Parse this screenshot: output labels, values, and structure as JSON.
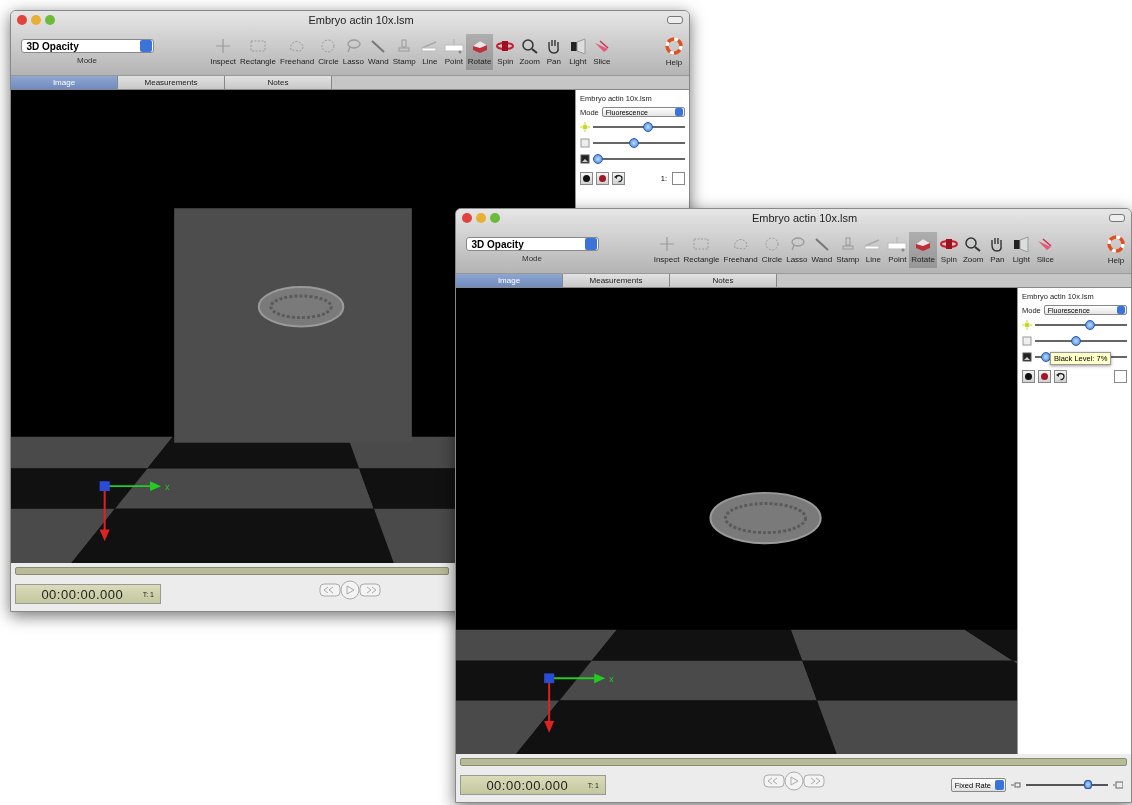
{
  "windows": [
    {
      "title": "Embryo actin 10x.lsm",
      "mode": {
        "value": "3D Opacity",
        "label": "Mode"
      },
      "tools": [
        {
          "label": "Inspect",
          "kind": "crosshair",
          "selected": false
        },
        {
          "label": "Rectangle",
          "kind": "rectangle",
          "selected": false
        },
        {
          "label": "Freehand",
          "kind": "freehand",
          "selected": false
        },
        {
          "label": "Circle",
          "kind": "circle",
          "selected": false
        },
        {
          "label": "Lasso",
          "kind": "lasso",
          "selected": false
        },
        {
          "label": "Wand",
          "kind": "wand",
          "selected": false
        },
        {
          "label": "Stamp",
          "kind": "stamp",
          "selected": false
        },
        {
          "label": "Line",
          "kind": "line",
          "selected": false
        },
        {
          "label": "Point",
          "kind": "point",
          "selected": false
        },
        {
          "label": "Rotate",
          "kind": "rotate",
          "selected": true
        },
        {
          "label": "Spin",
          "kind": "spin",
          "selected": false
        },
        {
          "label": "Zoom",
          "kind": "zoom",
          "selected": false
        },
        {
          "label": "Pan",
          "kind": "pan",
          "selected": false
        },
        {
          "label": "Light",
          "kind": "light",
          "selected": false
        },
        {
          "label": "Slice",
          "kind": "slice",
          "selected": false
        }
      ],
      "help": "Help",
      "tabs": [
        {
          "label": "Image",
          "selected": true
        },
        {
          "label": "Measurements",
          "selected": false
        },
        {
          "label": "Notes",
          "selected": false
        }
      ],
      "viewport": {
        "volume_plane": true,
        "axis_label": "x"
      },
      "panel": {
        "title": "Embryo actin 10x.lsm",
        "mode_label": "Mode",
        "mode_value": "Fluorescence",
        "sliders": [
          {
            "kind": "brightness",
            "level": 0.6
          },
          {
            "kind": "contrast",
            "level": 0.45
          },
          {
            "kind": "black",
            "level": 0.05
          }
        ],
        "channel_label": "1:",
        "channel_checked": false
      },
      "timecode": "00:00:00.000",
      "timepoint": "T: 1"
    },
    {
      "title": "Embryo actin 10x.lsm",
      "mode": {
        "value": "3D Opacity",
        "label": "Mode"
      },
      "tools": [
        {
          "label": "Inspect",
          "kind": "crosshair",
          "selected": false
        },
        {
          "label": "Rectangle",
          "kind": "rectangle",
          "selected": false
        },
        {
          "label": "Freehand",
          "kind": "freehand",
          "selected": false
        },
        {
          "label": "Circle",
          "kind": "circle",
          "selected": false
        },
        {
          "label": "Lasso",
          "kind": "lasso",
          "selected": false
        },
        {
          "label": "Wand",
          "kind": "wand",
          "selected": false
        },
        {
          "label": "Stamp",
          "kind": "stamp",
          "selected": false
        },
        {
          "label": "Line",
          "kind": "line",
          "selected": false
        },
        {
          "label": "Point",
          "kind": "point",
          "selected": false
        },
        {
          "label": "Rotate",
          "kind": "rotate",
          "selected": true
        },
        {
          "label": "Spin",
          "kind": "spin",
          "selected": false
        },
        {
          "label": "Zoom",
          "kind": "zoom",
          "selected": false
        },
        {
          "label": "Pan",
          "kind": "pan",
          "selected": false
        },
        {
          "label": "Light",
          "kind": "light",
          "selected": false
        },
        {
          "label": "Slice",
          "kind": "slice",
          "selected": false
        }
      ],
      "help": "Help",
      "tabs": [
        {
          "label": "Image",
          "selected": true
        },
        {
          "label": "Measurements",
          "selected": false
        },
        {
          "label": "Notes",
          "selected": false
        }
      ],
      "viewport": {
        "volume_plane": false,
        "axis_label": "x"
      },
      "panel": {
        "title": "Embryo actin 10x.lsm",
        "mode_label": "Mode",
        "mode_value": "Fluorescence",
        "sliders": [
          {
            "kind": "brightness",
            "level": 0.6
          },
          {
            "kind": "contrast",
            "level": 0.45
          },
          {
            "kind": "black",
            "level": 0.12
          }
        ],
        "channel_checked": false,
        "tooltip": "Black Level: 7%"
      },
      "timecode": "00:00:00.000",
      "timepoint": "T: 1",
      "rate": {
        "value": "Fixed Rate",
        "level": 0.75
      }
    }
  ]
}
